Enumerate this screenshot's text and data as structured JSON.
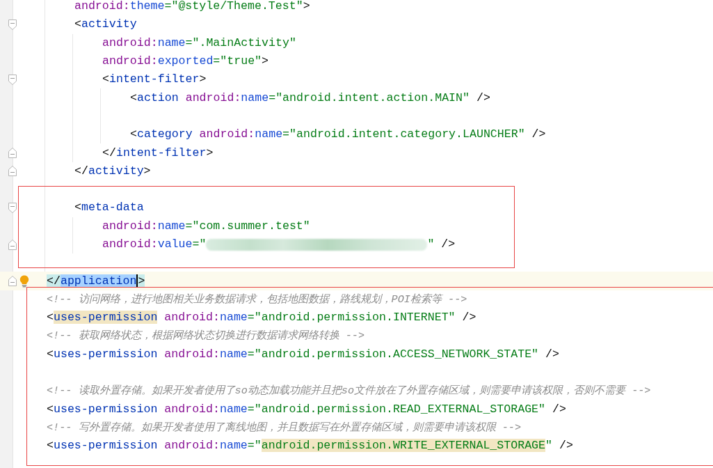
{
  "editor": {
    "lines": [
      {
        "kind": "block",
        "children": [
          {
            "kind": "line",
            "tokens": [
              {
                "kind": "ns",
                "text": "android:"
              },
              {
                "kind": "attr",
                "text": "theme"
              },
              {
                "kind": "str",
                "text": "=\"@style/Theme.Test\""
              },
              {
                "kind": "punct",
                "text": ">"
              }
            ]
          },
          {
            "kind": "line",
            "fold_start": true,
            "tokens": [
              {
                "kind": "punct",
                "text": "<"
              },
              {
                "kind": "tag",
                "text": "activity"
              }
            ],
            "children": [
              {
                "kind": "line",
                "tokens": [
                  {
                    "kind": "ns",
                    "text": "android:"
                  },
                  {
                    "kind": "attr",
                    "text": "name"
                  },
                  {
                    "kind": "str",
                    "text": "=\".MainActivity\""
                  }
                ]
              },
              {
                "kind": "line",
                "tokens": [
                  {
                    "kind": "ns",
                    "text": "android:"
                  },
                  {
                    "kind": "attr",
                    "text": "exported"
                  },
                  {
                    "kind": "str",
                    "text": "=\"true\""
                  },
                  {
                    "kind": "punct",
                    "text": ">"
                  }
                ]
              },
              {
                "kind": "line",
                "fold_start": true,
                "tokens": [
                  {
                    "kind": "punct",
                    "text": "<"
                  },
                  {
                    "kind": "tag",
                    "text": "intent-filter"
                  },
                  {
                    "kind": "punct",
                    "text": ">"
                  }
                ],
                "children": [
                  {
                    "kind": "line",
                    "tokens": [
                      {
                        "kind": "punct",
                        "text": "<"
                      },
                      {
                        "kind": "tag",
                        "text": "action"
                      },
                      {
                        "kind": "ns",
                        "text": " android:"
                      },
                      {
                        "kind": "attr",
                        "text": "name"
                      },
                      {
                        "kind": "str",
                        "text": "=\"android.intent.action.MAIN\""
                      },
                      {
                        "kind": "punct",
                        "text": " />"
                      }
                    ]
                  },
                  {
                    "kind": "blank"
                  },
                  {
                    "kind": "line",
                    "tokens": [
                      {
                        "kind": "punct",
                        "text": "<"
                      },
                      {
                        "kind": "tag",
                        "text": "category"
                      },
                      {
                        "kind": "ns",
                        "text": " android:"
                      },
                      {
                        "kind": "attr",
                        "text": "name"
                      },
                      {
                        "kind": "str",
                        "text": "=\"android.intent.category.LAUNCHER\""
                      },
                      {
                        "kind": "punct",
                        "text": " />"
                      }
                    ]
                  }
                ]
              },
              {
                "kind": "line",
                "fold_end": true,
                "tokens": [
                  {
                    "kind": "punct",
                    "text": "</"
                  },
                  {
                    "kind": "tag",
                    "text": "intent-filter"
                  },
                  {
                    "kind": "punct",
                    "text": ">"
                  }
                ]
              }
            ]
          },
          {
            "kind": "line",
            "fold_end": true,
            "tokens": [
              {
                "kind": "punct",
                "text": "</"
              },
              {
                "kind": "tag",
                "text": "activity"
              },
              {
                "kind": "punct",
                "text": ">"
              }
            ]
          },
          {
            "kind": "group",
            "boxed": true,
            "children": [
              {
                "kind": "blank"
              },
              {
                "kind": "line",
                "fold_start": true,
                "tokens": [
                  {
                    "kind": "punct",
                    "text": "<"
                  },
                  {
                    "kind": "tag",
                    "text": "meta-data"
                  }
                ],
                "children": [
                  {
                    "kind": "line",
                    "tokens": [
                      {
                        "kind": "ns",
                        "text": "android:"
                      },
                      {
                        "kind": "attr",
                        "text": "name"
                      },
                      {
                        "kind": "str",
                        "text": "=\"com.summer.test\""
                      }
                    ]
                  },
                  {
                    "kind": "line",
                    "fold_end": true,
                    "tokens": [
                      {
                        "kind": "ns",
                        "text": "android:"
                      },
                      {
                        "kind": "attr",
                        "text": "value"
                      },
                      {
                        "kind": "str",
                        "text": "=\""
                      },
                      {
                        "kind": "redacted"
                      },
                      {
                        "kind": "str",
                        "text": "\""
                      },
                      {
                        "kind": "punct",
                        "text": " />"
                      }
                    ]
                  }
                ]
              },
              {
                "kind": "blank"
              }
            ]
          }
        ]
      },
      {
        "kind": "line",
        "fold_end": true,
        "current": true,
        "intention": true,
        "tokens": [
          {
            "kind": "punct",
            "text": "</",
            "brace_match": true
          },
          {
            "kind": "tag",
            "text": "application",
            "selected": true,
            "caret": true
          },
          {
            "kind": "punct",
            "text": ">",
            "brace_match": true
          }
        ]
      },
      {
        "kind": "group",
        "boxed": true,
        "children": [
          {
            "kind": "line",
            "tokens": [
              {
                "kind": "comment",
                "text": "<!-- 访问网络，进行地图相关业务数据请求，包括地图数据，路线规划，POI检索等 -->"
              }
            ]
          },
          {
            "kind": "line",
            "tokens": [
              {
                "kind": "punct",
                "text": "<"
              },
              {
                "kind": "tag",
                "text": "uses-permission",
                "highlighted": true
              },
              {
                "kind": "ns",
                "text": " android:"
              },
              {
                "kind": "attr",
                "text": "name"
              },
              {
                "kind": "str",
                "text": "=\"android.permission.INTERNET\""
              },
              {
                "kind": "punct",
                "text": " />"
              }
            ]
          },
          {
            "kind": "line",
            "tokens": [
              {
                "kind": "comment",
                "text": "<!-- 获取网络状态，根据网络状态切换进行数据请求网络转换 -->"
              }
            ]
          },
          {
            "kind": "line",
            "tokens": [
              {
                "kind": "punct",
                "text": "<"
              },
              {
                "kind": "tag",
                "text": "uses-permission"
              },
              {
                "kind": "ns",
                "text": " android:"
              },
              {
                "kind": "attr",
                "text": "name"
              },
              {
                "kind": "str",
                "text": "=\"android.permission.ACCESS_NETWORK_STATE\""
              },
              {
                "kind": "punct",
                "text": " />"
              }
            ]
          },
          {
            "kind": "blank"
          },
          {
            "kind": "line",
            "tokens": [
              {
                "kind": "comment",
                "text": "<!-- 读取外置存储。如果开发者使用了so动态加载功能并且把so文件放在了外置存储区域，则需要申请该权限，否则不需要 -->"
              }
            ]
          },
          {
            "kind": "line",
            "tokens": [
              {
                "kind": "punct",
                "text": "<"
              },
              {
                "kind": "tag",
                "text": "uses-permission"
              },
              {
                "kind": "ns",
                "text": " android:"
              },
              {
                "kind": "attr",
                "text": "name"
              },
              {
                "kind": "str",
                "text": "=\"android.permission.READ_EXTERNAL_STORAGE\""
              },
              {
                "kind": "punct",
                "text": " />"
              }
            ]
          },
          {
            "kind": "line",
            "tokens": [
              {
                "kind": "comment",
                "text": "<!-- 写外置存储。如果开发者使用了离线地图，并且数据写在外置存储区域，则需要申请该权限 -->"
              }
            ]
          },
          {
            "kind": "line",
            "tokens": [
              {
                "kind": "punct",
                "text": "<"
              },
              {
                "kind": "tag",
                "text": "uses-permission"
              },
              {
                "kind": "ns",
                "text": " android:"
              },
              {
                "kind": "attr",
                "text": "name"
              },
              {
                "kind": "str",
                "text": "=\""
              },
              {
                "kind": "str",
                "text": "android.permission.WRITE_EXTERNAL_STORAGE",
                "highlighted": true
              },
              {
                "kind": "str",
                "text": "\""
              },
              {
                "kind": "punct",
                "text": " />"
              }
            ]
          }
        ]
      }
    ]
  }
}
